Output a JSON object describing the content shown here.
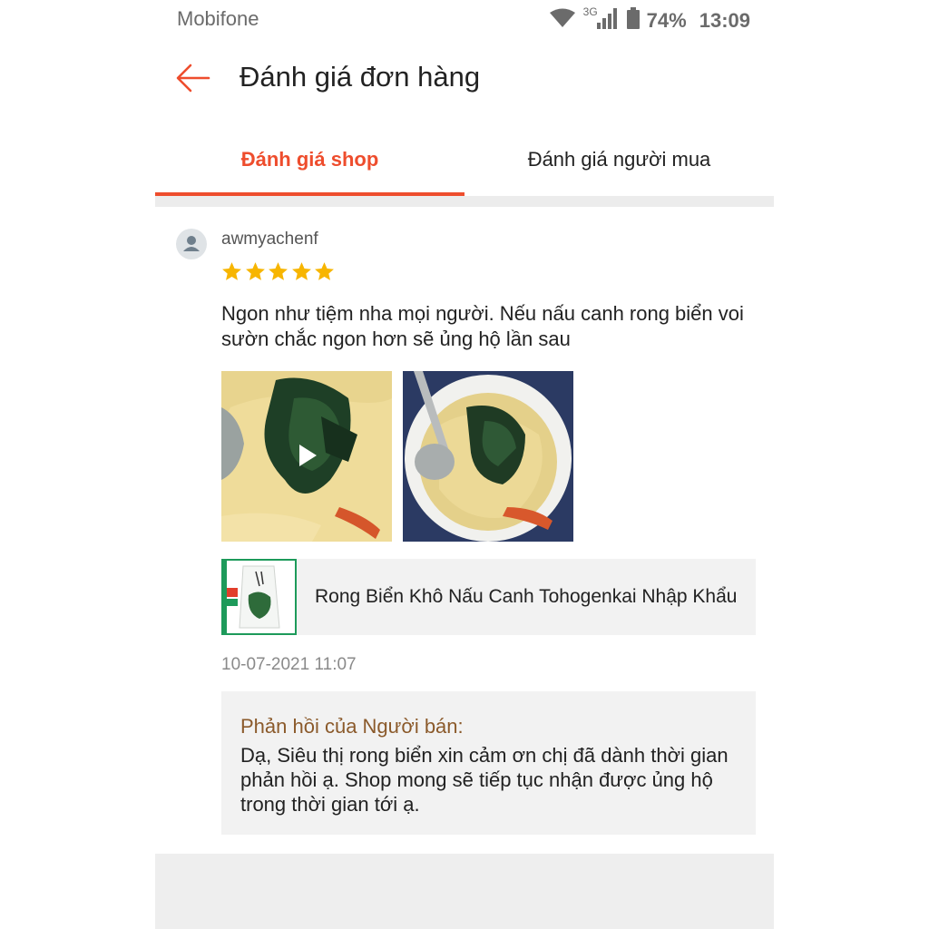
{
  "status_bar": {
    "carrier": "Mobifone",
    "network": "3G",
    "battery": "74%",
    "time": "13:09",
    "icons": [
      "wifi-icon",
      "signal-icon",
      "battery-icon"
    ]
  },
  "header": {
    "title": "Đánh giá đơn hàng",
    "back_icon": "back-arrow-icon"
  },
  "tabs": [
    {
      "label": "Đánh giá shop",
      "active": true
    },
    {
      "label": "Đánh giá người mua",
      "active": false
    }
  ],
  "review": {
    "username": "awmyachenf",
    "rating": 5,
    "text": "Ngon như tiệm nha mọi người. Nếu nấu canh rong biển voi sườn chắc ngon hơn sẽ ủng hộ lần sau",
    "media": [
      {
        "kind": "video",
        "icon": "play-icon"
      },
      {
        "kind": "image"
      }
    ],
    "product_name": "Rong Biển Khô Nấu Canh Tohogenkai Nhập Khẩu",
    "datetime": "10-07-2021 11:07",
    "seller_reply": {
      "title": "Phản hồi của Người bán:",
      "text": "Dạ, Siêu thị rong biển xin cảm ơn chị đã dành thời gian phản hồi ạ. Shop mong sẽ tiếp tục nhận được ủng hộ trong thời gian tới ạ."
    }
  },
  "colors": {
    "accent": "#ee4d2d",
    "star": "#f7b500",
    "reply_title": "#8b5a2b"
  }
}
